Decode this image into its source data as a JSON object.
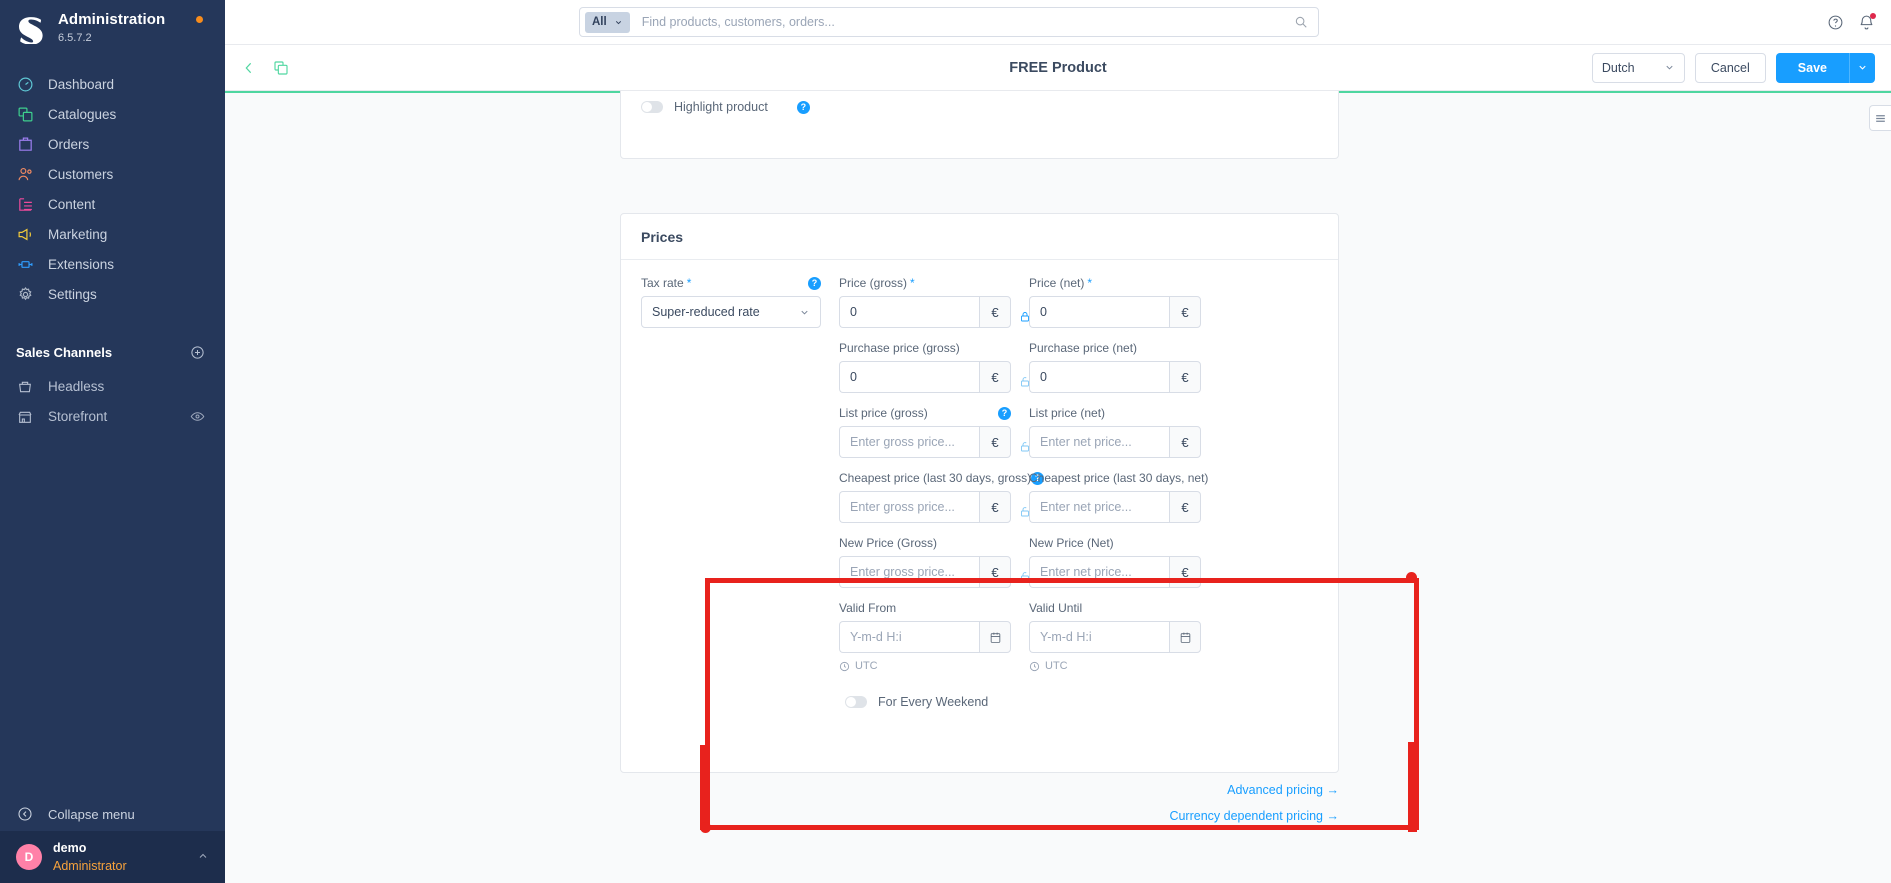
{
  "sidebar": {
    "brand": {
      "title": "Administration",
      "version": "6.5.7.2",
      "logo_icon": "shopware-logo-icon",
      "status_dot_color": "#f88c1c"
    },
    "items": [
      {
        "label": "Dashboard",
        "icon": "dashboard-icon",
        "color": "#5fc7d4"
      },
      {
        "label": "Catalogues",
        "icon": "catalogues-icon",
        "color": "#3ecf8e"
      },
      {
        "label": "Orders",
        "icon": "orders-icon",
        "color": "#9d7ff0"
      },
      {
        "label": "Customers",
        "icon": "customers-icon",
        "color": "#f08a62"
      },
      {
        "label": "Content",
        "icon": "content-icon",
        "color": "#ef4a9b"
      },
      {
        "label": "Marketing",
        "icon": "marketing-icon",
        "color": "#f4cb3a"
      },
      {
        "label": "Extensions",
        "icon": "extensions-icon",
        "color": "#2f9dff"
      },
      {
        "label": "Settings",
        "icon": "settings-gear-icon",
        "color": "#aab4c4"
      }
    ],
    "sales_channels": {
      "title": "Sales Channels",
      "add_icon": "plus-circle-icon",
      "items": [
        {
          "label": "Headless",
          "icon": "basket-icon",
          "has_eye": false
        },
        {
          "label": "Storefront",
          "icon": "storefront-icon",
          "has_eye": true,
          "eye_icon": "eye-icon"
        }
      ]
    },
    "collapse": {
      "label": "Collapse menu",
      "icon": "collapse-left-icon"
    },
    "user": {
      "initial": "D",
      "name": "demo",
      "role": "Administrator",
      "caret_icon": "chevron-up-icon",
      "avatar_color": "#ff81a8"
    }
  },
  "topbar": {
    "search": {
      "scope": "All",
      "scope_caret_icon": "chevron-down-icon",
      "placeholder": "Find products, customers, orders...",
      "value": "",
      "search_icon": "search-icon"
    },
    "help_icon": "help-circle-icon",
    "notifications_icon": "bell-icon",
    "notifications_badge_color": "#de294c"
  },
  "smartbar": {
    "back_icon": "chevron-left-icon",
    "duplicate_icon": "duplicate-icon",
    "title": "FREE Product",
    "language": {
      "value": "Dutch",
      "caret_icon": "chevron-down-icon"
    },
    "cancel_label": "Cancel",
    "save_label": "Save",
    "save_caret_icon": "chevron-down-icon",
    "accent_color": "#189eff"
  },
  "content": {
    "side_tab_icon": "list-view-icon",
    "top_accent_color": "#4fd6a0",
    "highlight_card": {
      "toggle_label": "Highlight product",
      "toggle_on": false,
      "help_icon": "help-dot-icon"
    },
    "prices_card": {
      "title": "Prices",
      "tax_rate": {
        "label": "Tax rate",
        "required": true,
        "value": "Super-reduced rate",
        "help_icon": "help-dot-icon",
        "caret_icon": "chevron-down-icon"
      },
      "rows": [
        {
          "gross": {
            "label": "Price (gross)",
            "required": true,
            "value": "0",
            "placeholder": "",
            "suffix": "€"
          },
          "net": {
            "label": "Price (net)",
            "required": true,
            "value": "0",
            "placeholder": "",
            "suffix": "€"
          },
          "lock_icon": "lock-closed-icon",
          "lock_locked": true,
          "help_icon": null
        },
        {
          "gross": {
            "label": "Purchase price (gross)",
            "required": false,
            "value": "0",
            "placeholder": "",
            "suffix": "€"
          },
          "net": {
            "label": "Purchase price (net)",
            "required": false,
            "value": "0",
            "placeholder": "",
            "suffix": "€"
          },
          "lock_icon": "lock-open-icon",
          "lock_locked": false,
          "help_icon": null
        },
        {
          "gross": {
            "label": "List price (gross)",
            "required": false,
            "value": "",
            "placeholder": "Enter gross price...",
            "suffix": "€"
          },
          "net": {
            "label": "List price (net)",
            "required": false,
            "value": "",
            "placeholder": "Enter net price...",
            "suffix": "€"
          },
          "lock_icon": "lock-open-icon",
          "lock_locked": false,
          "help_icon": "help-dot-icon"
        },
        {
          "gross": {
            "label": "Cheapest price (last 30 days, gross)",
            "required": false,
            "value": "",
            "placeholder": "Enter gross price...",
            "suffix": "€"
          },
          "net": {
            "label": "Cheapest price (last 30 days, net)",
            "required": false,
            "value": "",
            "placeholder": "Enter net price...",
            "suffix": "€"
          },
          "lock_icon": "lock-open-icon",
          "lock_locked": false,
          "help_icon": "help-dot-icon"
        },
        {
          "gross": {
            "label": "New Price (Gross)",
            "required": false,
            "value": "",
            "placeholder": "Enter gross price...",
            "suffix": "€"
          },
          "net": {
            "label": "New Price (Net)",
            "required": false,
            "value": "",
            "placeholder": "Enter net price...",
            "suffix": "€"
          },
          "lock_icon": "lock-open-icon",
          "lock_locked": false,
          "help_icon": null
        }
      ],
      "valid_from": {
        "label": "Valid From",
        "value": "",
        "placeholder": "Y-m-d H:i",
        "calendar_icon": "calendar-icon",
        "timezone": "UTC",
        "clock_icon": "clock-icon"
      },
      "valid_until": {
        "label": "Valid Until",
        "value": "",
        "placeholder": "Y-m-d H:i",
        "calendar_icon": "calendar-icon",
        "timezone": "UTC",
        "clock_icon": "clock-icon"
      },
      "weekend_toggle": {
        "label": "For Every Weekend",
        "on": false
      },
      "links": [
        {
          "label": "Advanced pricing",
          "arrow": "→"
        },
        {
          "label": "Currency dependent pricing",
          "arrow": "→"
        }
      ]
    },
    "annotation": {
      "color": "#e8221d",
      "shape": "rectangle"
    }
  }
}
